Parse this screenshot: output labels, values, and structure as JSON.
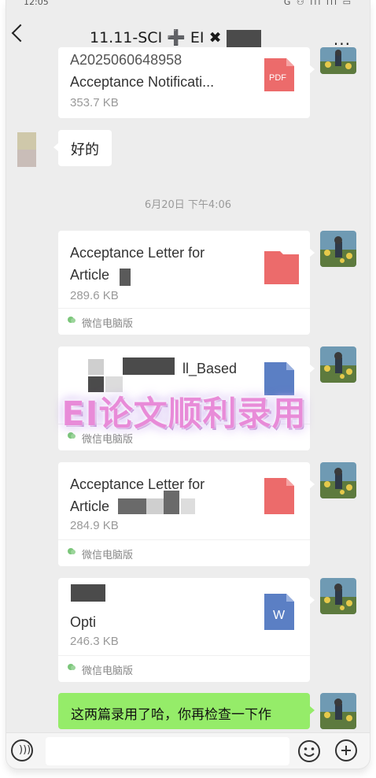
{
  "status": {
    "time": "12:05",
    "right": "G ⚇ ıll ıll ▭"
  },
  "header": {
    "title": "11.11-SCI ➕ EI ✖ 3-",
    "more": "···"
  },
  "messages": {
    "card0": {
      "name_top": "A2025060648958",
      "name": "Acceptance Notificati...",
      "size": "353.7 KB",
      "icon": "pdf-icon",
      "icon_label": "PDF"
    },
    "reply": "好的",
    "timestamp": "6月20日 下午4:06",
    "card1": {
      "name": "Acceptance Letter for Article",
      "size": "289.6 KB",
      "source": "微信电脑版",
      "icon": "pdf-icon"
    },
    "card2": {
      "name": "ll_Based",
      "size": "",
      "source": "微信电脑版",
      "icon": "word-icon"
    },
    "card3": {
      "name": "Acceptance Letter for Article",
      "size": "284.9 KB",
      "source": "微信电脑版",
      "icon": "pdf-icon"
    },
    "card4": {
      "name": "Opti",
      "size": "246.3 KB",
      "source": "微信电脑版",
      "icon": "word-icon",
      "icon_label": "W"
    },
    "sent": "这两篇录用了哈，你再检查一下作"
  },
  "overlay": {
    "text": "EI论文顺利录用"
  },
  "colors": {
    "pdf": "#ec6b6b",
    "word": "#5b7fc4",
    "sent_bubble": "#95ec69",
    "overlay": "#e88bd8"
  }
}
